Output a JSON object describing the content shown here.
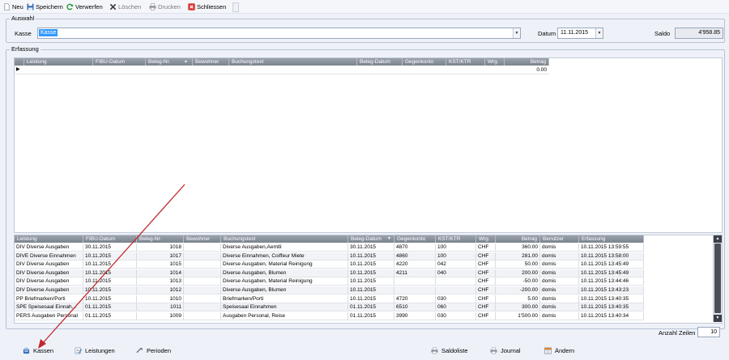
{
  "toolbar": {
    "new_label": "Neu",
    "save_label": "Speichern",
    "discard_label": "Verwerfen",
    "delete_label": "Löschen",
    "print_label": "Drucken",
    "close_label": "Schliessen"
  },
  "selection": {
    "group_title": "Auswahl",
    "kasse_label": "Kasse",
    "kasse_value": "Kasse",
    "datum_label": "Datum",
    "datum_value": "11.11.2015",
    "saldo_label": "Saldo",
    "saldo_value": "4'958.85"
  },
  "entry": {
    "group_title": "Erfassung",
    "columns": [
      "Leistung",
      "FIBU-Datum",
      "Beleg-Nr.",
      "Bewohner",
      "Buchungstext",
      "Beleg-Datum",
      "Gegenkonto",
      "KST/KTR",
      "Wrg.",
      "Betrag"
    ],
    "row_betrag": "0.00"
  },
  "journal": {
    "columns": [
      "Leistung",
      "FIBU-Datum",
      "Beleg-Nr.",
      "Bewohner",
      "Buchungstext",
      "Beleg-Datum",
      "Gegenkonto",
      "KST/KTR",
      "Wrg.",
      "Betrag",
      "Benutzer",
      "Erfassung"
    ],
    "rows": [
      {
        "leistung": "DIV Diverse Ausgaben",
        "fibu": "30.11.2015",
        "beleg": "1018",
        "bewohner": "",
        "text": "Diverse Ausgaben,Aemtli",
        "beleg_datum": "30.11.2015",
        "gegenkonto": "4870",
        "kst": "100",
        "wrg": "CHF",
        "betrag": "360.00",
        "benutzer": "domis",
        "erfassung": "10.11.2015 13:59:55"
      },
      {
        "leistung": "DIVE Diverse Einnahmen",
        "fibu": "10.11.2015",
        "beleg": "1017",
        "bewohner": "",
        "text": "Diverse Einnahmen, Coiffeur Miete",
        "beleg_datum": "10.11.2015",
        "gegenkonto": "4860",
        "kst": "100",
        "wrg": "CHF",
        "betrag": "281.00",
        "benutzer": "domis",
        "erfassung": "10.11.2015 13:58:00"
      },
      {
        "leistung": "DIV Diverse Ausgaben",
        "fibu": "10.11.2015",
        "beleg": "1015",
        "bewohner": "",
        "text": "Diverse Ausgaben, Material Reinigung",
        "beleg_datum": "10.11.2015",
        "gegenkonto": "4220",
        "kst": "042",
        "wrg": "CHF",
        "betrag": "50.00",
        "benutzer": "domis",
        "erfassung": "10.11.2015 13:45:49"
      },
      {
        "leistung": "DIV Diverse Ausgaben",
        "fibu": "10.11.2015",
        "beleg": "1014",
        "bewohner": "",
        "text": "Diverse Ausgaben, Blumen",
        "beleg_datum": "10.11.2015",
        "gegenkonto": "4211",
        "kst": "040",
        "wrg": "CHF",
        "betrag": "200.00",
        "benutzer": "domis",
        "erfassung": "10.11.2015 13:45:49"
      },
      {
        "leistung": "DIV Diverse Ausgaben",
        "fibu": "10.11.2015",
        "beleg": "1013",
        "bewohner": "",
        "text": "Diverse Ausgaben, Material Reinigung",
        "beleg_datum": "10.11.2015",
        "gegenkonto": "",
        "kst": "",
        "wrg": "CHF",
        "betrag": "-50.00",
        "benutzer": "domis",
        "erfassung": "10.11.2015 13:44:46"
      },
      {
        "leistung": "DIV Diverse Ausgaben",
        "fibu": "10.11.2015",
        "beleg": "1012",
        "bewohner": "",
        "text": "Diverse Ausgaben, Blumen",
        "beleg_datum": "10.11.2015",
        "gegenkonto": "",
        "kst": "",
        "wrg": "CHF",
        "betrag": "-200.00",
        "benutzer": "domis",
        "erfassung": "10.11.2015 13:43:23"
      },
      {
        "leistung": "PP Briefmarken/Porti",
        "fibu": "10.11.2015",
        "beleg": "1010",
        "bewohner": "",
        "text": "Briefmarken/Porti",
        "beleg_datum": "10.11.2015",
        "gegenkonto": "4720",
        "kst": "030",
        "wrg": "CHF",
        "betrag": "5.00",
        "benutzer": "domis",
        "erfassung": "10.11.2015 13:40:35"
      },
      {
        "leistung": "SPE Speisesaal Einnah...",
        "fibu": "01.11.2015",
        "beleg": "1011",
        "bewohner": "",
        "text": "Speisesaal Einnahmen",
        "beleg_datum": "01.11.2015",
        "gegenkonto": "6510",
        "kst": "060",
        "wrg": "CHF",
        "betrag": "300.00",
        "benutzer": "domis",
        "erfassung": "10.11.2015 13:40:35"
      },
      {
        "leistung": "PERS Ausgaben Personal",
        "fibu": "01.11.2015",
        "beleg": "1009",
        "bewohner": "",
        "text": "Ausgaben Personal, Reise",
        "beleg_datum": "01.11.2015",
        "gegenkonto": "3990",
        "kst": "030",
        "wrg": "CHF",
        "betrag": "1'500.00",
        "benutzer": "domis",
        "erfassung": "10.11.2015 13:40:34"
      }
    ],
    "anzahl_label": "Anzahl Zeilen",
    "anzahl_value": "10"
  },
  "bottom_bar": {
    "kassen_label": "Kassen",
    "leistungen_label": "Leistungen",
    "perioden_label": "Perioden",
    "saldoliste_label": "Saldoliste",
    "journal_label": "Journal",
    "aendern_label": "Ändern"
  },
  "colors": {
    "accent_selection": "#3399ff",
    "header_gray": "#8a929c",
    "annotation_arrow": "#c0282d"
  }
}
